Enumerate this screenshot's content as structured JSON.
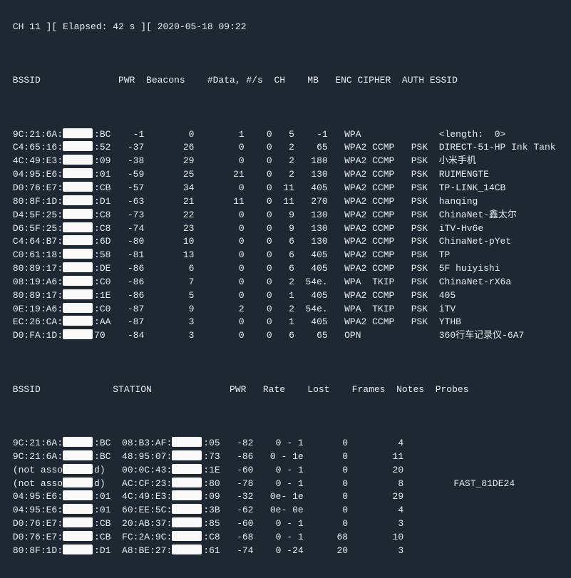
{
  "status": {
    "ch": "CH 11",
    "elapsed": "Elapsed: 42 s",
    "ts": "2020-05-18 09:22"
  },
  "ap_header": {
    "c0": "BSSID",
    "c1": "PWR",
    "c2": "Beacons",
    "c3": "#Data, #/s",
    "c4": "CH",
    "c5": "MB",
    "c6": "ENC CIPHER",
    "c7": "AUTH",
    "c8": "ESSID"
  },
  "aps": [
    {
      "b1": "9C:21:6A:",
      "b2": ":BC",
      "pwr": "-1",
      "bcn": "0",
      "data": "1",
      "ps": "0",
      "ch": "5",
      "mb": "-1",
      "enc": "WPA",
      "auth": "",
      "essid": "<length:  0>"
    },
    {
      "b1": "C4:65:16:",
      "b2": ":52",
      "pwr": "-37",
      "bcn": "26",
      "data": "0",
      "ps": "0",
      "ch": "2",
      "mb": "65",
      "enc": "WPA2 CCMP",
      "auth": "PSK",
      "essid": "DIRECT-51-HP Ink Tank"
    },
    {
      "b1": "4C:49:E3:",
      "b2": ":09",
      "pwr": "-38",
      "bcn": "29",
      "data": "0",
      "ps": "0",
      "ch": "2",
      "mb": "180",
      "enc": "WPA2 CCMP",
      "auth": "PSK",
      "essid": "小米手机"
    },
    {
      "b1": "04:95:E6:",
      "b2": ":01",
      "pwr": "-59",
      "bcn": "25",
      "data": "21",
      "ps": "0",
      "ch": "2",
      "mb": "130",
      "enc": "WPA2 CCMP",
      "auth": "PSK",
      "essid": "RUIMENGTE"
    },
    {
      "b1": "D0:76:E7:",
      "b2": ":CB",
      "pwr": "-57",
      "bcn": "34",
      "data": "0",
      "ps": "0",
      "ch": "11",
      "mb": "405",
      "enc": "WPA2 CCMP",
      "auth": "PSK",
      "essid": "TP-LINK_14CB"
    },
    {
      "b1": "80:8F:1D:",
      "b2": ":D1",
      "pwr": "-63",
      "bcn": "21",
      "data": "11",
      "ps": "0",
      "ch": "11",
      "mb": "270",
      "enc": "WPA2 CCMP",
      "auth": "PSK",
      "essid": "hanqing"
    },
    {
      "b1": "D4:5F:25:",
      "b2": ":C8",
      "pwr": "-73",
      "bcn": "22",
      "data": "0",
      "ps": "0",
      "ch": "9",
      "mb": "130",
      "enc": "WPA2 CCMP",
      "auth": "PSK",
      "essid": "ChinaNet-鑫太尔"
    },
    {
      "b1": "D6:5F:25:",
      "b2": ":C8",
      "pwr": "-74",
      "bcn": "23",
      "data": "0",
      "ps": "0",
      "ch": "9",
      "mb": "130",
      "enc": "WPA2 CCMP",
      "auth": "PSK",
      "essid": "iTV-Hv6e"
    },
    {
      "b1": "C4:64:B7:",
      "b2": ":6D",
      "pwr": "-80",
      "bcn": "10",
      "data": "0",
      "ps": "0",
      "ch": "6",
      "mb": "130",
      "enc": "WPA2 CCMP",
      "auth": "PSK",
      "essid": "ChinaNet-pYet"
    },
    {
      "b1": "C0:61:18:",
      "b2": ":58",
      "pwr": "-81",
      "bcn": "13",
      "data": "0",
      "ps": "0",
      "ch": "6",
      "mb": "405",
      "enc": "WPA2 CCMP",
      "auth": "PSK",
      "essid": "TP"
    },
    {
      "b1": "80:89:17:",
      "b2": ":DE",
      "pwr": "-86",
      "bcn": "6",
      "data": "0",
      "ps": "0",
      "ch": "6",
      "mb": "405",
      "enc": "WPA2 CCMP",
      "auth": "PSK",
      "essid": "5F huiyishi"
    },
    {
      "b1": "08:19:A6:",
      "b2": ":C0",
      "pwr": "-86",
      "bcn": "7",
      "data": "0",
      "ps": "0",
      "ch": "2",
      "mb": "54e.",
      "enc": "WPA  TKIP",
      "auth": "PSK",
      "essid": "ChinaNet-rX6a"
    },
    {
      "b1": "80:89:17:",
      "b2": ":1E",
      "pwr": "-86",
      "bcn": "5",
      "data": "0",
      "ps": "0",
      "ch": "1",
      "mb": "405",
      "enc": "WPA2 CCMP",
      "auth": "PSK",
      "essid": "405"
    },
    {
      "b1": "0E:19:A6:",
      "b2": ":C0",
      "pwr": "-87",
      "bcn": "9",
      "data": "2",
      "ps": "0",
      "ch": "2",
      "mb": "54e.",
      "enc": "WPA  TKIP",
      "auth": "PSK",
      "essid": "iTV"
    },
    {
      "b1": "EC:26:CA:",
      "b2": ":AA",
      "pwr": "-87",
      "bcn": "3",
      "data": "0",
      "ps": "0",
      "ch": "1",
      "mb": "405",
      "enc": "WPA2 CCMP",
      "auth": "PSK",
      "essid": "YTHB"
    },
    {
      "b1": "D0:FA:1D:",
      "b2": "70",
      "pwr": "-84",
      "bcn": "3",
      "data": "0",
      "ps": "0",
      "ch": "6",
      "mb": "65",
      "enc": "OPN",
      "auth": "",
      "essid": "360行车记录仪-6A7"
    }
  ],
  "st_header": {
    "c0": "BSSID",
    "c1": "STATION",
    "c2": "PWR",
    "c3": "Rate",
    "c4": "Lost",
    "c5": "Frames",
    "c6": "Notes",
    "c7": "Probes"
  },
  "sts": [
    {
      "b1": "9C:21:6A:",
      "b2": ":BC",
      "s1": "08:B3:AF:",
      "s2": ":05",
      "pwr": "-82",
      "rate": " 0 - 1",
      "lost": "0",
      "fr": "4",
      "probes": ""
    },
    {
      "b1": "9C:21:6A:",
      "b2": ":BC",
      "s1": "48:95:07:",
      "s2": ":73",
      "pwr": "-86",
      "rate": " 0 - 1e",
      "lost": "0",
      "fr": "11",
      "probes": ""
    },
    {
      "b1": "(not asso",
      "b2": "d)",
      "s1": "00:0C:43:",
      "s2": ":1E",
      "pwr": "-60",
      "rate": " 0 - 1",
      "lost": "0",
      "fr": "20",
      "probes": ""
    },
    {
      "b1": "(not asso",
      "b2": "d)",
      "s1": "AC:CF:23:",
      "s2": ":80",
      "pwr": "-78",
      "rate": " 0 - 1",
      "lost": "0",
      "fr": "8",
      "probes": "FAST_81DE24"
    },
    {
      "b1": "04:95:E6:",
      "b2": ":01",
      "s1": "4C:49:E3:",
      "s2": ":09",
      "pwr": "-32",
      "rate": " 0e- 1e",
      "lost": "0",
      "fr": "29",
      "probes": ""
    },
    {
      "b1": "04:95:E6:",
      "b2": ":01",
      "s1": "60:EE:5C:",
      "s2": ":3B",
      "pwr": "-62",
      "rate": " 0e- 0e",
      "lost": "0",
      "fr": "4",
      "probes": ""
    },
    {
      "b1": "D0:76:E7:",
      "b2": ":CB",
      "s1": "20:AB:37:",
      "s2": ":85",
      "pwr": "-60",
      "rate": " 0 - 1",
      "lost": "0",
      "fr": "3",
      "probes": ""
    },
    {
      "b1": "D0:76:E7:",
      "b2": ":CB",
      "s1": "FC:2A:9C:",
      "s2": ":C8",
      "pwr": "-68",
      "rate": " 0 - 1",
      "lost": "68",
      "fr": "10",
      "probes": ""
    },
    {
      "b1": "80:8F:1D:",
      "b2": ":D1",
      "s1": "A8:BE:27:",
      "s2": ":61",
      "pwr": "-74",
      "rate": " 0 -24",
      "lost": "20",
      "fr": "3",
      "probes": ""
    }
  ]
}
